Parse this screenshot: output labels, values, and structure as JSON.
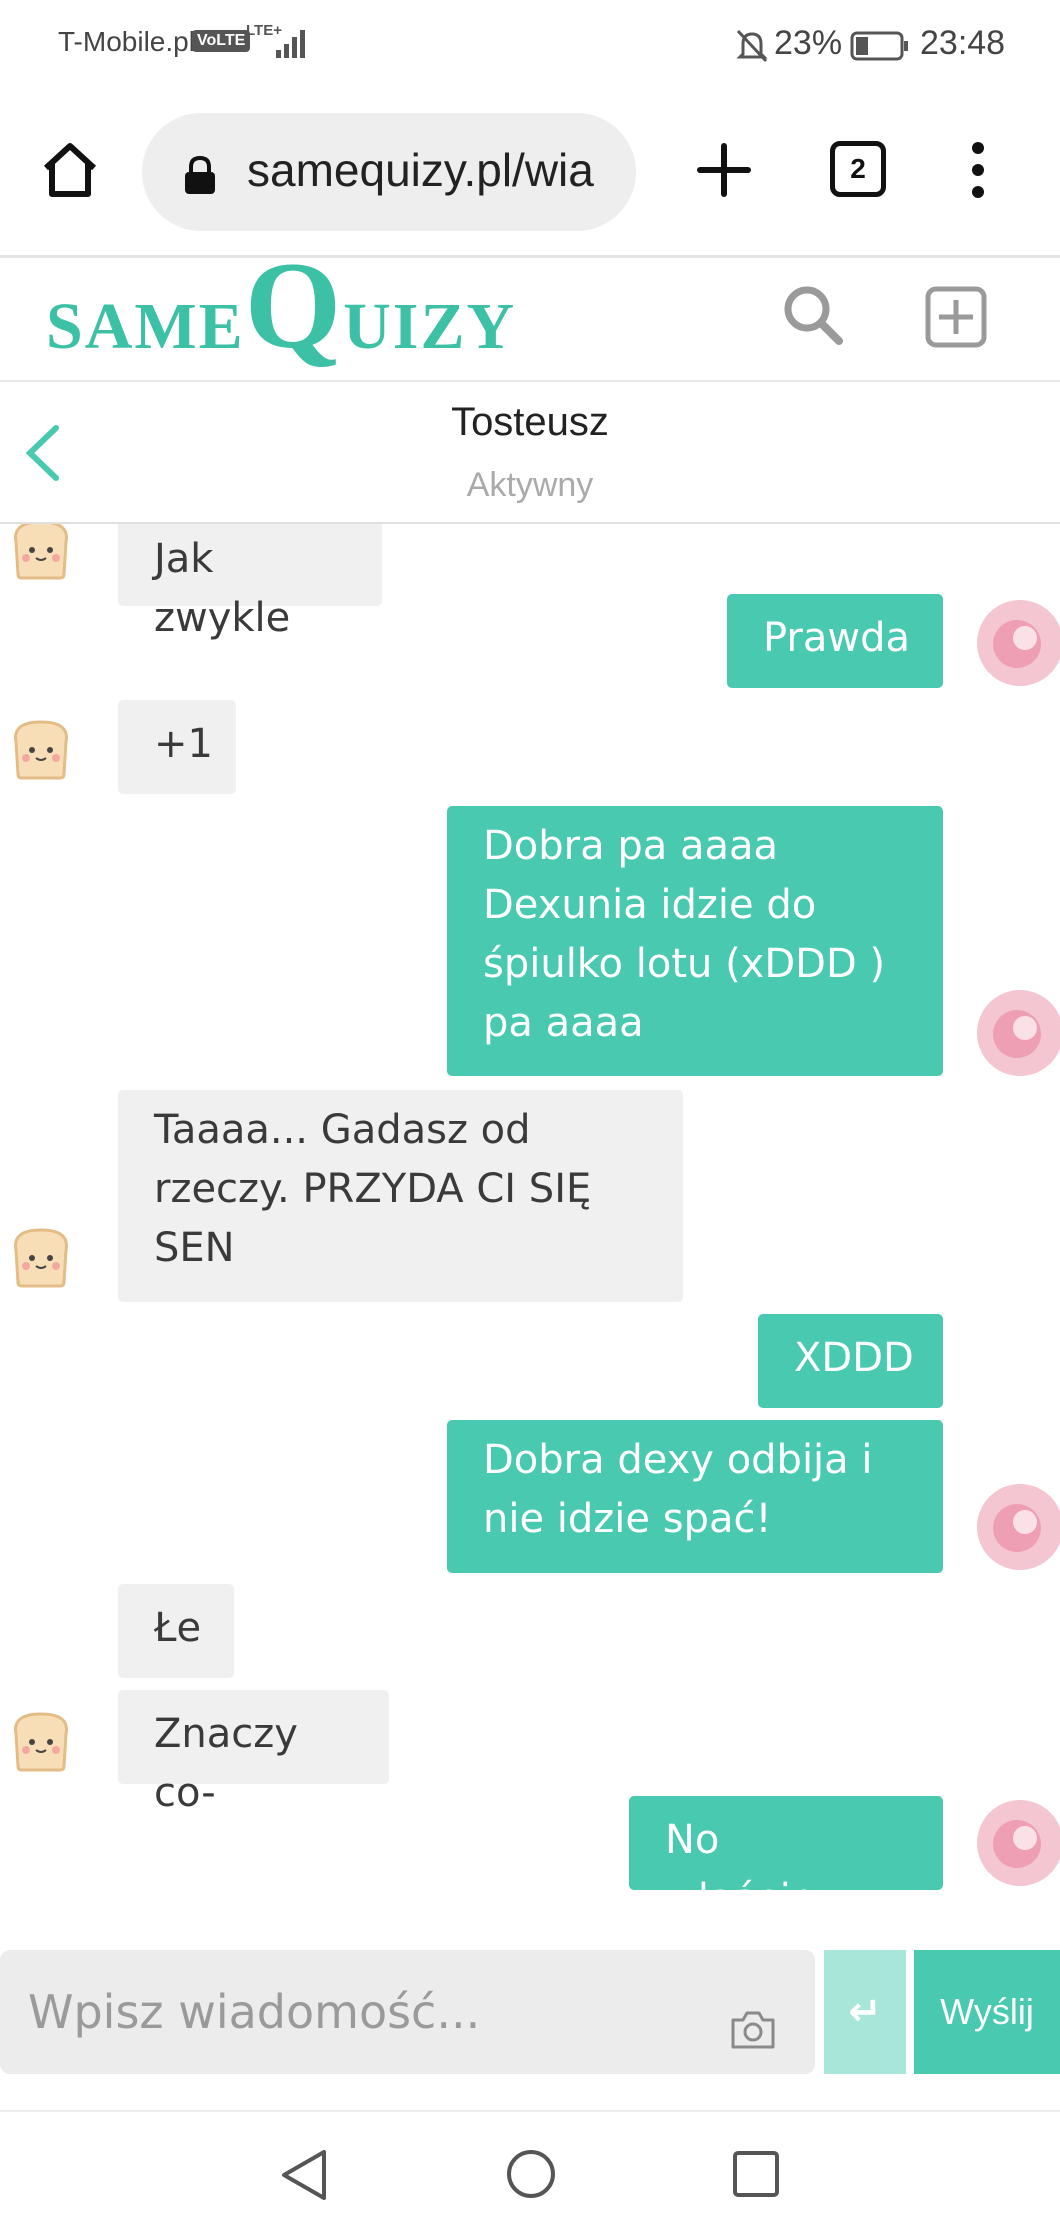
{
  "status_bar": {
    "carrier": "T-Mobile.pl",
    "volte": "VoLTE",
    "network": "LTE+",
    "battery": "23%",
    "time": "23:48"
  },
  "browser": {
    "url": "samequizy.pl/wia",
    "tab_count": "2",
    "icons": [
      "home-icon",
      "lock-icon",
      "plus-icon",
      "tabs-icon",
      "more-vert-icon"
    ]
  },
  "site": {
    "logo_same": "SAME",
    "logo_q": "Q",
    "logo_uizy": "UIZY",
    "brand_color": "#3cc0a6",
    "icons": [
      "search-icon",
      "add-square-icon"
    ]
  },
  "chat": {
    "contact_name": "Tosteusz",
    "contact_status": "Aktywny",
    "messages": [
      {
        "side": "in",
        "text": "Jak zwykle"
      },
      {
        "side": "out",
        "text": "Prawda"
      },
      {
        "side": "in",
        "text": "+1"
      },
      {
        "side": "out",
        "lines": [
          "Dobra pa aaaa",
          "Dexunia idzie do",
          "śpiulko lotu (xDDD )",
          "pa aaaa"
        ]
      },
      {
        "side": "in",
        "lines": [
          "Taaaa... Gadasz od",
          "rzeczy. PRZYDA CI SIĘ",
          "SEN"
        ]
      },
      {
        "side": "out",
        "text": "XDDD"
      },
      {
        "side": "out",
        "lines": [
          "Dobra dexy odbija i",
          "nie idzie spać!"
        ]
      },
      {
        "side": "in",
        "text": "Łe"
      },
      {
        "side": "in",
        "text": "Znaczy co-"
      },
      {
        "side": "out",
        "text": "No właśnie..."
      }
    ]
  },
  "composer": {
    "placeholder": "Wpisz wiadomość...",
    "enter_symbol": "↵",
    "send_label": "Wyślij",
    "accent": "#48c9b0"
  }
}
